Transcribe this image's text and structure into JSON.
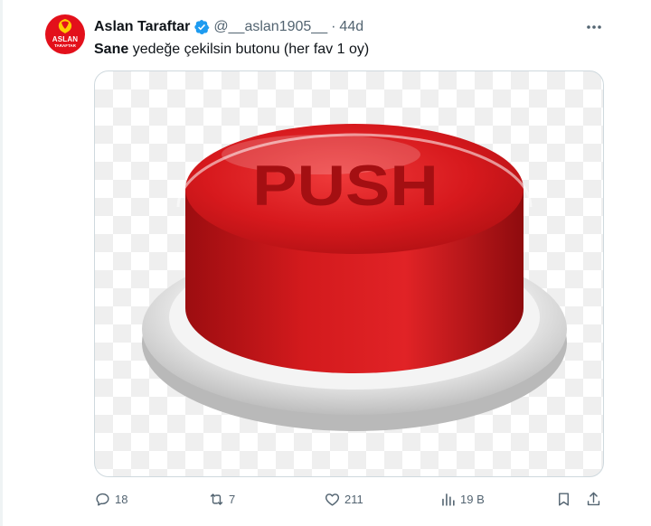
{
  "tweet": {
    "avatar": {
      "line1": "ASLAN",
      "line2": "TARAFTAR",
      "bg_color": "#e3101b"
    },
    "display_name": "Aslan Taraftar",
    "verified": true,
    "handle": "@__aslan1905__",
    "separator": "·",
    "time": "44d",
    "text_bold": "Sane",
    "text_rest": " yedeğe çekilsin butonu (her fav 1 oy)",
    "media": {
      "button_text": "PUSH",
      "button_color": "#d7191d"
    }
  },
  "actions": {
    "replies": "18",
    "retweets": "7",
    "likes": "211",
    "views": "19 B"
  },
  "colors": {
    "text_primary": "#0f1419",
    "text_secondary": "#536471",
    "verified_blue": "#1d9bf0"
  }
}
